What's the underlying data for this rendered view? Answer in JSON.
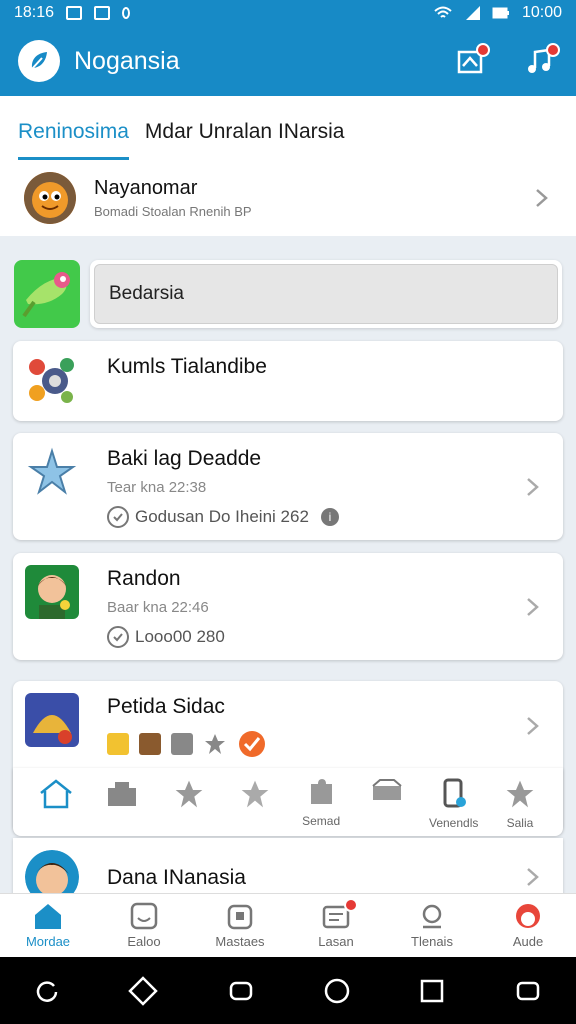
{
  "status_bar": {
    "time_left": "18:16",
    "time_right": "10:00"
  },
  "app": {
    "title": "Nogansia"
  },
  "tabs": [
    {
      "label": "Reninosima",
      "active": true
    },
    {
      "label": "Mdar Unralan INarsia",
      "active": false
    }
  ],
  "profile": {
    "name": "Nayanomar",
    "subtitle": "Bomadi Stoalan Rnenih BP"
  },
  "search": {
    "value": "Bedarsia"
  },
  "cards": [
    {
      "title": "Kumls Tialandibe"
    },
    {
      "title": "Baki lag Deadde",
      "time": "Tear kna 22:38",
      "status": "Godusan Do Iheini 262"
    },
    {
      "title": "Randon",
      "time": "Baar kna 22:46",
      "status": "Looo00 280"
    },
    {
      "title": "Petida Sidac"
    }
  ],
  "quick_actions": [
    {
      "label": "",
      "icon": "home-icon"
    },
    {
      "label": "",
      "icon": "building-icon"
    },
    {
      "label": "",
      "icon": "star-icon"
    },
    {
      "label": "",
      "icon": "star-outline-icon"
    },
    {
      "label": "Semad",
      "icon": "puzzle-icon"
    },
    {
      "label": "",
      "icon": "box-icon"
    },
    {
      "label": "Venendls",
      "icon": "device-icon"
    },
    {
      "label": "Salia",
      "icon": "star-icon"
    }
  ],
  "last_card": {
    "title": "Dana INanasia"
  },
  "bottom_nav": [
    {
      "label": "Mordae",
      "active": true
    },
    {
      "label": "Ealoo",
      "active": false
    },
    {
      "label": "Mastaes",
      "active": false
    },
    {
      "label": "Lasan",
      "active": false
    },
    {
      "label": "Tlenais",
      "active": false
    },
    {
      "label": "Aude",
      "active": false
    }
  ],
  "colors": {
    "primary": "#178ac6",
    "accent_badge": "#e53935",
    "background": "#e9eef3"
  }
}
